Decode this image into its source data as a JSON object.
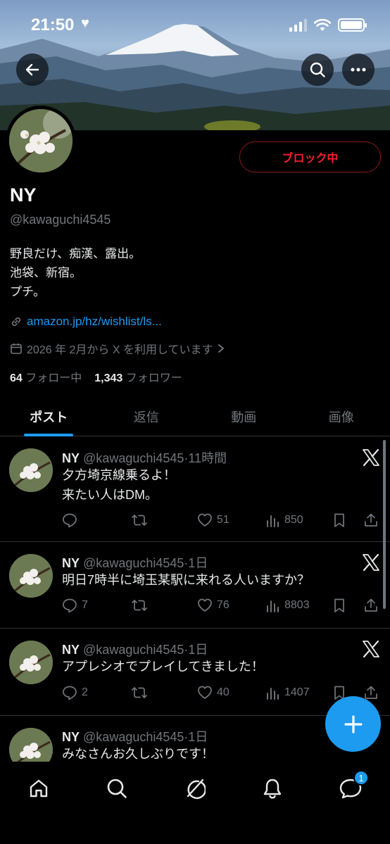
{
  "status_bar": {
    "time": "21:50"
  },
  "profile": {
    "display_name": "NY",
    "handle": "@kawaguchi4545",
    "block_label": "ブロック中",
    "bio": [
      "野良だけ、痴漢、露出。",
      "池袋、新宿。",
      "プチ。"
    ],
    "link": "amazon.jp/hz/wishlist/ls...",
    "joined": "2026 年 2月から X を利用しています",
    "following_count": "64",
    "following_label": "フォロー中",
    "followers_count": "1,343",
    "followers_label": "フォロワー"
  },
  "tabs": [
    {
      "label": "ポスト",
      "active": true
    },
    {
      "label": "返信",
      "active": false
    },
    {
      "label": "動画",
      "active": false
    },
    {
      "label": "画像",
      "active": false
    }
  ],
  "posts": [
    {
      "name": "NY",
      "handle": "@kawaguchi4545",
      "time": "11時間",
      "lines": [
        "夕方埼京線乗るよ！",
        "来たい人はDM。"
      ],
      "replies": "",
      "likes": "51",
      "views": "850"
    },
    {
      "name": "NY",
      "handle": "@kawaguchi4545",
      "time": "1日",
      "lines": [
        "明日7時半に埼玉某駅に来れる人いますか？"
      ],
      "replies": "7",
      "likes": "76",
      "views": "8803"
    },
    {
      "name": "NY",
      "handle": "@kawaguchi4545",
      "time": "1日",
      "lines": [
        "アプレシオでプレイしてきました！"
      ],
      "replies": "2",
      "likes": "40",
      "views": "1407"
    },
    {
      "name": "NY",
      "handle": "@kawaguchi4545",
      "time": "1日",
      "lines": [
        "みなさんお久しぶりです！"
      ],
      "replies": "",
      "likes": "",
      "views": ""
    }
  ],
  "nav": {
    "messages_badge": "1"
  },
  "icons": [
    "back-arrow-icon",
    "search-icon",
    "more-icon",
    "link-icon",
    "calendar-icon",
    "chevron-right-icon",
    "reply-icon",
    "repost-icon",
    "like-icon",
    "views-icon",
    "bookmark-icon",
    "share-icon",
    "x-logo-icon",
    "compose-plus-icon",
    "home-icon",
    "grok-icon",
    "bell-icon",
    "messages-icon"
  ],
  "colors": {
    "accent": "#1d9bf0",
    "block_red": "#f4212e",
    "muted": "#71767b"
  }
}
